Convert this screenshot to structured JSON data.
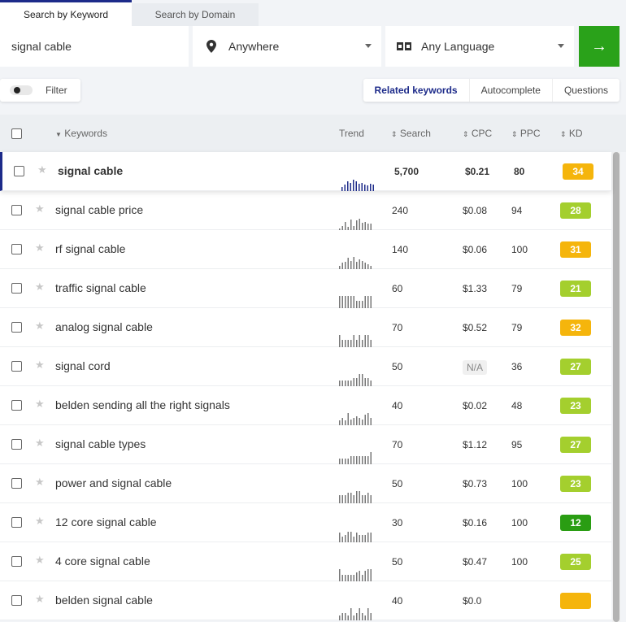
{
  "tabs": [
    "Search by Keyword",
    "Search by Domain"
  ],
  "search": {
    "keyword": "signal cable",
    "location": "Anywhere",
    "language": "Any Language",
    "go_icon": "arrow-right-icon"
  },
  "filter": {
    "label": "Filter",
    "enabled": false
  },
  "modes": [
    "Related keywords",
    "Autocomplete",
    "Questions"
  ],
  "columns": {
    "keywords": "Keywords",
    "trend": "Trend",
    "search": "Search",
    "cpc": "CPC",
    "ppc": "PPC",
    "kd": "KD"
  },
  "colors": {
    "kd_yellow": "#f5b50c",
    "kd_lightgreen": "#a4cf2e",
    "kd_green": "#2a9d13",
    "accent": "#1d2b8a",
    "go": "#2aa21a"
  },
  "rows": [
    {
      "keyword": "signal cable",
      "search": "5,700",
      "cpc": "$0.21",
      "ppc": "80",
      "kd": "34",
      "kd_color": "#f5b50c",
      "trend": [
        5,
        8,
        12,
        10,
        14,
        12,
        9,
        10,
        8,
        7,
        9,
        8
      ]
    },
    {
      "keyword": "signal cable price",
      "search": "240",
      "cpc": "$0.08",
      "ppc": "94",
      "kd": "28",
      "kd_color": "#a4cf2e",
      "trend": [
        2,
        5,
        10,
        4,
        13,
        5,
        12,
        14,
        9,
        10,
        8,
        8
      ]
    },
    {
      "keyword": "rf signal cable",
      "search": "140",
      "cpc": "$0.06",
      "ppc": "100",
      "kd": "31",
      "kd_color": "#f5b50c",
      "trend": [
        4,
        8,
        9,
        14,
        10,
        15,
        9,
        12,
        10,
        8,
        6,
        4
      ]
    },
    {
      "keyword": "traffic signal cable",
      "search": "60",
      "cpc": "$1.33",
      "ppc": "79",
      "kd": "21",
      "kd_color": "#a4cf2e",
      "trend": [
        15,
        15,
        15,
        15,
        15,
        15,
        9,
        9,
        9,
        15,
        15,
        15
      ]
    },
    {
      "keyword": "analog signal cable",
      "search": "70",
      "cpc": "$0.52",
      "ppc": "79",
      "kd": "32",
      "kd_color": "#f5b50c",
      "trend": [
        15,
        9,
        9,
        9,
        9,
        15,
        9,
        15,
        9,
        15,
        15,
        9
      ]
    },
    {
      "keyword": "signal cord",
      "search": "50",
      "cpc": "N/A",
      "ppc": "36",
      "kd": "27",
      "kd_color": "#a4cf2e",
      "trend": [
        7,
        7,
        7,
        7,
        7,
        10,
        10,
        15,
        15,
        10,
        10,
        7
      ]
    },
    {
      "keyword": "belden sending all the right signals",
      "search": "40",
      "cpc": "$0.02",
      "ppc": "48",
      "kd": "23",
      "kd_color": "#a4cf2e",
      "trend": [
        6,
        9,
        6,
        15,
        7,
        9,
        11,
        9,
        7,
        13,
        15,
        9
      ]
    },
    {
      "keyword": "signal cable types",
      "search": "70",
      "cpc": "$1.12",
      "ppc": "95",
      "kd": "27",
      "kd_color": "#a4cf2e",
      "trend": [
        7,
        7,
        7,
        7,
        10,
        10,
        10,
        10,
        10,
        10,
        10,
        15
      ]
    },
    {
      "keyword": "power and signal cable",
      "search": "50",
      "cpc": "$0.73",
      "ppc": "100",
      "kd": "23",
      "kd_color": "#a4cf2e",
      "trend": [
        10,
        10,
        10,
        13,
        13,
        10,
        15,
        15,
        10,
        10,
        13,
        10
      ]
    },
    {
      "keyword": "12 core signal cable",
      "search": "30",
      "cpc": "$0.16",
      "ppc": "100",
      "kd": "12",
      "kd_color": "#2a9d13",
      "trend": [
        12,
        7,
        9,
        13,
        13,
        7,
        12,
        9,
        9,
        9,
        12,
        12
      ]
    },
    {
      "keyword": "4 core signal cable",
      "search": "50",
      "cpc": "$0.47",
      "ppc": "100",
      "kd": "25",
      "kd_color": "#a4cf2e",
      "trend": [
        15,
        8,
        8,
        8,
        8,
        8,
        11,
        13,
        8,
        13,
        15,
        15
      ]
    },
    {
      "keyword": "belden signal cable",
      "search": "40",
      "cpc": "$0.0",
      "ppc": "",
      "kd": "",
      "kd_color": "#f5b50c",
      "trend": [
        6,
        9,
        9,
        6,
        15,
        6,
        9,
        15,
        9,
        6,
        15,
        9
      ]
    }
  ]
}
